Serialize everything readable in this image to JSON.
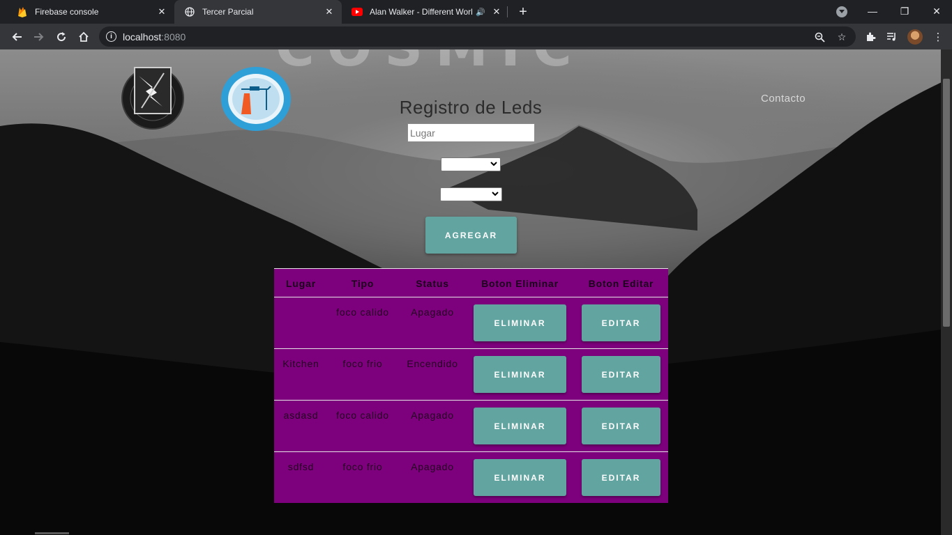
{
  "browser": {
    "tabs": [
      {
        "title": "Firebase console",
        "icon": "firebase-icon"
      },
      {
        "title": "Tercer Parcial",
        "icon": "globe-icon"
      },
      {
        "title": "Alan Walker - Different World",
        "icon": "youtube-icon"
      }
    ],
    "address": {
      "host": "localhost",
      "port": ":8080"
    }
  },
  "page": {
    "watermark": "COSMIC",
    "contact_link": "Contacto",
    "form": {
      "title": "Registro de Leds",
      "lugar_placeholder": "Lugar",
      "select1_value": "",
      "select2_value": "",
      "add_button": "AGREGAR"
    },
    "table": {
      "headers": {
        "lugar": "Lugar",
        "tipo": "Tipo",
        "status": "Status",
        "eliminar": "Boton Eliminar",
        "editar": "Boton Editar"
      },
      "rows": [
        {
          "lugar": "",
          "tipo": "foco calido",
          "status": "Apagado",
          "delete_label": "ELIMINAR",
          "edit_label": "EDITAR"
        },
        {
          "lugar": "Kitchen",
          "tipo": "foco frio",
          "status": "Encendido",
          "delete_label": "ELIMINAR",
          "edit_label": "EDITAR"
        },
        {
          "lugar": "asdasd",
          "tipo": "foco calido",
          "status": "Apagado",
          "delete_label": "ELIMINAR",
          "edit_label": "EDITAR"
        },
        {
          "lugar": "sdfsd",
          "tipo": "foco frio",
          "status": "Apagado",
          "delete_label": "ELIMINAR",
          "edit_label": "EDITAR"
        }
      ]
    }
  },
  "colors": {
    "table_bg": "#7d017d",
    "button_bg": "#61a4a0"
  }
}
